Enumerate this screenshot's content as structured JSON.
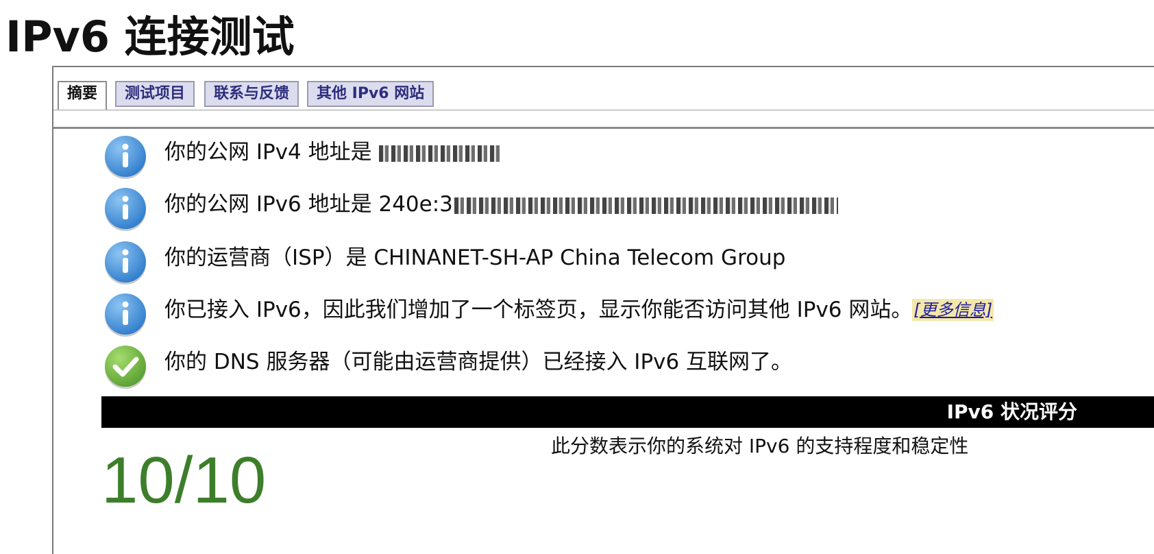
{
  "page": {
    "title": "IPv6 连接测试"
  },
  "tabs": [
    {
      "label": "摘要",
      "active": true
    },
    {
      "label": "测试项目",
      "active": false
    },
    {
      "label": "联系与反馈",
      "active": false
    },
    {
      "label": "其他 IPv6 网站",
      "active": false
    }
  ],
  "messages": [
    {
      "icon": "info-icon",
      "text": "你的公网 IPv4 地址是",
      "value_redacted": true
    },
    {
      "icon": "info-icon",
      "text": "你的公网 IPv6 地址是 240e:3",
      "value_redacted": true
    },
    {
      "icon": "info-icon",
      "text": "你的运营商（ISP）是 CHINANET-SH-AP China Telecom Group"
    },
    {
      "icon": "info-icon",
      "text": "你已接入 IPv6，因此我们增加了一个标签页，显示你能否访问其他 IPv6 网站。",
      "link": "[更多信息]"
    },
    {
      "icon": "check-icon",
      "text": "你的 DNS 服务器（可能由运营商提供）已经接入 IPv6 互联网了。"
    }
  ],
  "score": {
    "header": "IPv6 状况评分",
    "value": "10/10",
    "description": "此分数表示你的系统对 IPv6 的支持程度和稳定性"
  },
  "colors": {
    "info_icon": "#3f8fd8",
    "check_icon": "#6cb33f",
    "score_value": "#3d7e2a",
    "tab_bg": "#dcdcef",
    "tab_text": "#2e2e7e",
    "link_highlight": "#f4e7a8"
  }
}
